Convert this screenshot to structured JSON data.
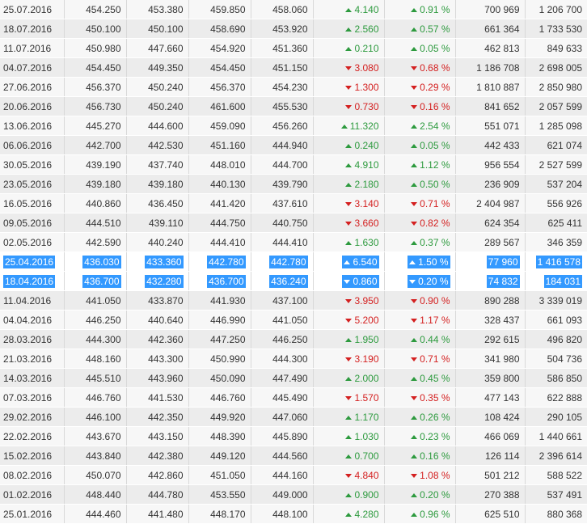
{
  "rows": [
    [
      "25.07.2016",
      "454.250",
      "453.380",
      "459.850",
      "458.060",
      "up",
      "4.140",
      "0.91 %",
      "700 969",
      "1 206 700"
    ],
    [
      "18.07.2016",
      "450.100",
      "450.100",
      "458.690",
      "453.920",
      "up",
      "2.560",
      "0.57 %",
      "661 364",
      "1 733 530"
    ],
    [
      "11.07.2016",
      "450.980",
      "447.660",
      "454.920",
      "451.360",
      "up",
      "0.210",
      "0.05 %",
      "462 813",
      "849 633"
    ],
    [
      "04.07.2016",
      "454.450",
      "449.350",
      "454.450",
      "451.150",
      "down",
      "3.080",
      "0.68 %",
      "1 186 708",
      "2 698 005"
    ],
    [
      "27.06.2016",
      "456.370",
      "450.240",
      "456.370",
      "454.230",
      "down",
      "1.300",
      "0.29 %",
      "1 810 887",
      "2 850 980"
    ],
    [
      "20.06.2016",
      "456.730",
      "450.240",
      "461.600",
      "455.530",
      "down",
      "0.730",
      "0.16 %",
      "841 652",
      "2 057 599"
    ],
    [
      "13.06.2016",
      "445.270",
      "444.600",
      "459.090",
      "456.260",
      "up",
      "11.320",
      "2.54 %",
      "551 071",
      "1 285 098"
    ],
    [
      "06.06.2016",
      "442.700",
      "442.530",
      "451.160",
      "444.940",
      "up",
      "0.240",
      "0.05 %",
      "442 433",
      "621 074"
    ],
    [
      "30.05.2016",
      "439.190",
      "437.740",
      "448.010",
      "444.700",
      "up",
      "4.910",
      "1.12 %",
      "956 554",
      "2 527 599"
    ],
    [
      "23.05.2016",
      "439.180",
      "439.180",
      "440.130",
      "439.790",
      "up",
      "2.180",
      "0.50 %",
      "236 909",
      "537 204"
    ],
    [
      "16.05.2016",
      "440.860",
      "436.450",
      "441.420",
      "437.610",
      "down",
      "3.140",
      "0.71 %",
      "2 404 987",
      "556 926"
    ],
    [
      "09.05.2016",
      "444.510",
      "439.110",
      "444.750",
      "440.750",
      "down",
      "3.660",
      "0.82 %",
      "624 354",
      "625 411"
    ],
    [
      "02.05.2016",
      "442.590",
      "440.240",
      "444.410",
      "444.410",
      "up",
      "1.630",
      "0.37 %",
      "289 567",
      "346 359"
    ],
    [
      "25.04.2016",
      "436.030",
      "433.360",
      "442.780",
      "442.780",
      "up",
      "6.540",
      "1.50 %",
      "77 960",
      "1 416 578"
    ],
    [
      "18.04.2016",
      "436.700",
      "432.280",
      "436.700",
      "436.240",
      "down",
      "0.860",
      "0.20 %",
      "74 832",
      "184 031"
    ],
    [
      "11.04.2016",
      "441.050",
      "433.870",
      "441.930",
      "437.100",
      "down",
      "3.950",
      "0.90 %",
      "890 288",
      "3 339 019"
    ],
    [
      "04.04.2016",
      "446.250",
      "440.640",
      "446.990",
      "441.050",
      "down",
      "5.200",
      "1.17 %",
      "328 437",
      "661 093"
    ],
    [
      "28.03.2016",
      "444.300",
      "442.360",
      "447.250",
      "446.250",
      "up",
      "1.950",
      "0.44 %",
      "292 615",
      "496 820"
    ],
    [
      "21.03.2016",
      "448.160",
      "443.300",
      "450.990",
      "444.300",
      "down",
      "3.190",
      "0.71 %",
      "341 980",
      "504 736"
    ],
    [
      "14.03.2016",
      "445.510",
      "443.960",
      "450.090",
      "447.490",
      "up",
      "2.000",
      "0.45 %",
      "359 800",
      "586 850"
    ],
    [
      "07.03.2016",
      "446.760",
      "441.530",
      "446.760",
      "445.490",
      "down",
      "1.570",
      "0.35 %",
      "477 143",
      "622 888"
    ],
    [
      "29.02.2016",
      "446.100",
      "442.350",
      "449.920",
      "447.060",
      "up",
      "1.170",
      "0.26 %",
      "108 424",
      "290 105"
    ],
    [
      "22.02.2016",
      "443.670",
      "443.150",
      "448.390",
      "445.890",
      "up",
      "1.030",
      "0.23 %",
      "466 069",
      "1 440 661"
    ],
    [
      "15.02.2016",
      "443.840",
      "442.380",
      "449.120",
      "444.560",
      "up",
      "0.700",
      "0.16 %",
      "126 114",
      "2 396 614"
    ],
    [
      "08.02.2016",
      "450.070",
      "442.860",
      "451.050",
      "444.160",
      "down",
      "4.840",
      "1.08 %",
      "501 212",
      "588 522"
    ],
    [
      "01.02.2016",
      "448.440",
      "444.780",
      "453.550",
      "449.000",
      "up",
      "0.900",
      "0.20 %",
      "270 388",
      "537 491"
    ],
    [
      "25.01.2016",
      "444.460",
      "441.480",
      "448.170",
      "448.100",
      "up",
      "4.280",
      "0.96 %",
      "625 510",
      "880 368"
    ]
  ],
  "selected_dates": [
    "25.04.2016",
    "18.04.2016"
  ],
  "colors": {
    "positive": "#2d9a3e",
    "negative": "#d42020",
    "selection": "#3399ff"
  }
}
